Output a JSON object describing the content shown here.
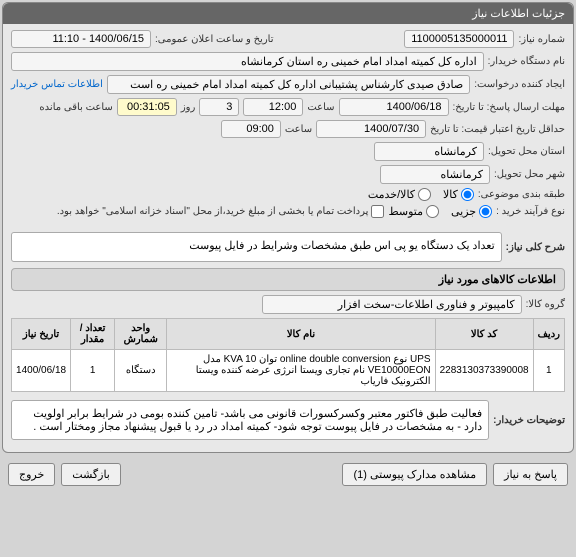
{
  "panel_title": "جزئیات اطلاعات نیاز",
  "row1": {
    "need_number_label": "شماره نیاز:",
    "need_number": "1100005135000011",
    "date_label": "تاریخ و ساعت اعلان عمومی:",
    "date_value": "1400/06/15 - 11:10"
  },
  "row2": {
    "buyer_label": "نام دستگاه خریدار:",
    "buyer_value": "اداره کل کمیته امداد امام خمینی ره استان کرمانشاه"
  },
  "row3": {
    "creator_label": "ایجاد کننده درخواست:",
    "creator_value": "صادق صیدی کارشناس پشتیبانی اداره کل کمیته امداد امام خمینی ره است",
    "contact_link": "اطلاعات تماس خریدار"
  },
  "row4": {
    "deadline_label": "مهلت ارسال پاسخ: تا تاریخ:",
    "deadline_date": "1400/06/18",
    "time_label": "ساعت",
    "deadline_time": "12:00",
    "days_value": "3",
    "days_suffix": "روز",
    "remaining_value": "00:31:05",
    "remaining_label": "ساعت باقی مانده"
  },
  "row5": {
    "validity_label": "حداقل تاریخ اعتبار قیمت: تا تاریخ",
    "validity_date": "1400/07/30",
    "time_label": "ساعت",
    "validity_time": "09:00"
  },
  "row6": {
    "province_label": "استان محل تحویل:",
    "province_value": "کرمانشاه"
  },
  "row7": {
    "city_label": "شهر محل تحویل:",
    "city_value": "کرمانشاه"
  },
  "row8": {
    "topic_label": "طبقه بندی موضوعی:",
    "opt1": "کالا",
    "opt2": "کالا/خدمت"
  },
  "row9": {
    "process_label": "نوع فرآیند خرید :",
    "opt1": "جزیی",
    "opt2": "متوسط",
    "note": "پرداخت تمام یا بخشی از مبلغ خرید،از محل \"اسناد خزانه اسلامی\" خواهد بود."
  },
  "need_desc": {
    "label": "شرح کلی نیاز:",
    "value": "تعداد یک دستگاه یو پی اس طبق مشخصات وشرایط در فایل پیوست"
  },
  "goods_section": "اطلاعات کالاهای مورد نیاز",
  "group": {
    "label": "گروه کالا:",
    "value": "کامپیوتر و فناوری اطلاعات-سخت افزار"
  },
  "table": {
    "headers": {
      "row": "ردیف",
      "code": "کد کالا",
      "name": "نام کالا",
      "unit": "واحد شمارش",
      "qty": "تعداد / مقدار",
      "date": "تاریخ نیاز"
    },
    "rows": [
      {
        "row": "1",
        "code": "2283130373390008",
        "name": "UPS نوع online double conversion توان KVA 10 مدل VE10000EON نام تجاری ویستا انرژی عرضه کننده ویستا الکترونیک فاریاب",
        "unit": "دستگاه",
        "qty": "1",
        "date": "1400/06/18"
      }
    ]
  },
  "buyer_note": {
    "label": "توضیحات خریدار:",
    "value": "فعالیت طبق فاکتور معتبر وکسرکسورات قانونی می باشد- تامین کننده بومی در شرایط برابر اولویت دارد - به مشخصات در فایل پیوست توجه شود- کمیته امداد در رد یا قبول پیشنهاد مجاز ومختار است ."
  },
  "buttons": {
    "reply": "پاسخ به نیاز",
    "attachments": "مشاهده مدارک پیوستی (1)",
    "back": "بازگشت",
    "exit": "خروج"
  }
}
